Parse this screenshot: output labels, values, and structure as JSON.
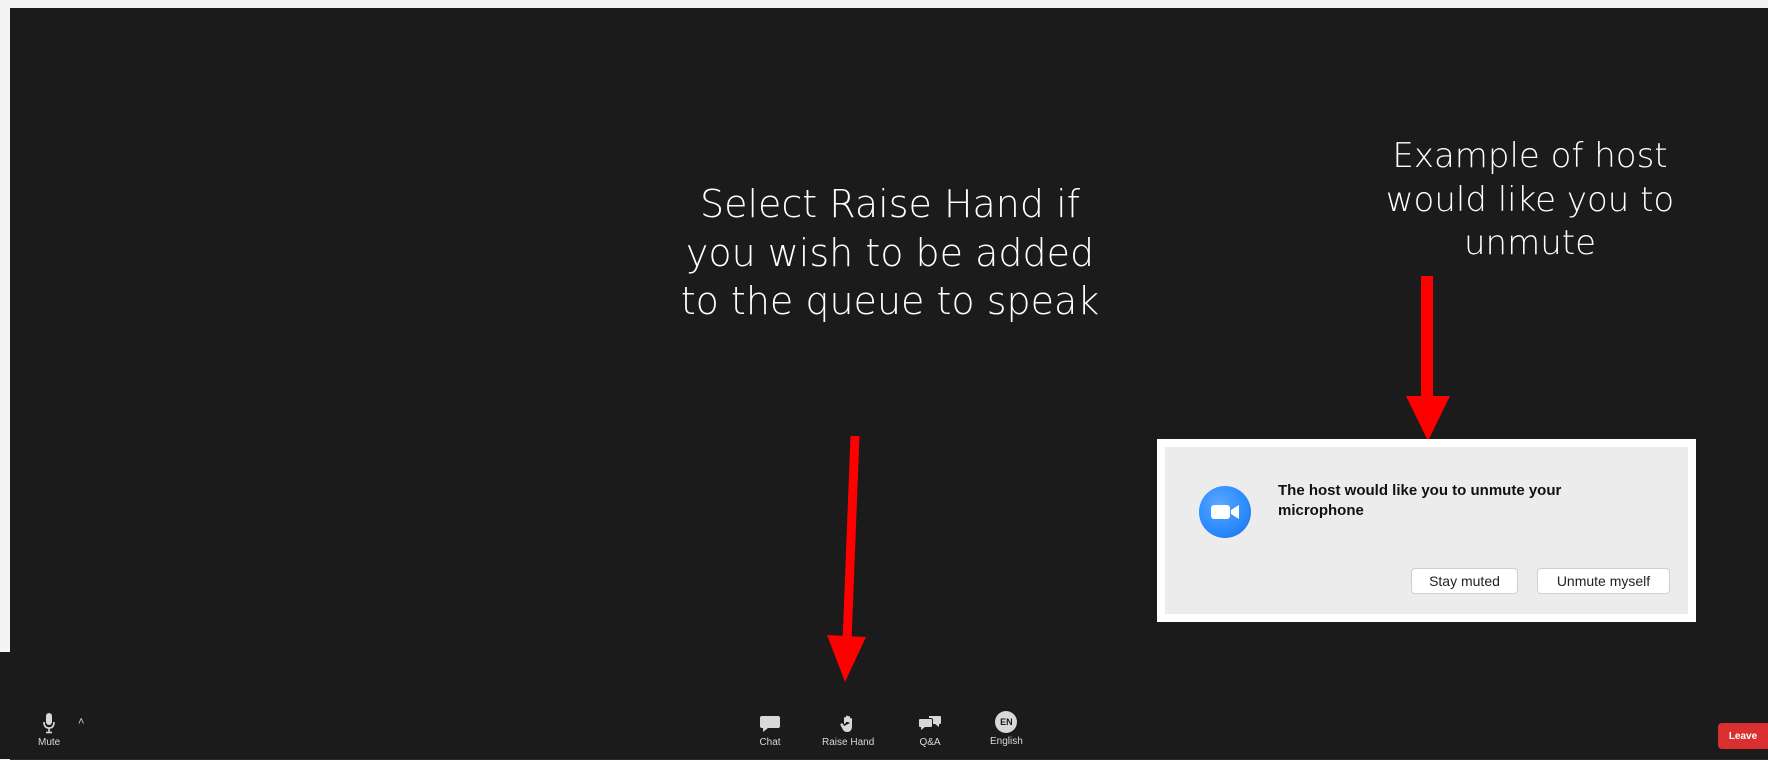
{
  "annotations": {
    "raise_hand_instruction": "Select Raise Hand if\nyou wish to be added\nto the queue to speak",
    "host_example": "Example of host\nwould like you to\nunmute"
  },
  "notification": {
    "message": "The host would like you to unmute your microphone",
    "stay_muted_label": "Stay muted",
    "unmute_label": "Unmute myself",
    "logo_color": "#2D8CFF"
  },
  "toolbar": {
    "mute_label": "Mute",
    "chat_label": "Chat",
    "raise_hand_label": "Raise Hand",
    "qa_label": "Q&A",
    "english_label": "English",
    "english_badge": "EN",
    "leave_label": "Leave"
  },
  "colors": {
    "background": "#1B1B1B",
    "arrow": "#FF0000",
    "leave": "#D9302F"
  },
  "icons": {
    "mute": "microphone-icon",
    "chat": "chat-bubble-icon",
    "raise_hand": "hand-icon",
    "qa": "qa-bubbles-icon",
    "english": "language-badge-icon",
    "logo": "zoom-camera-icon"
  }
}
